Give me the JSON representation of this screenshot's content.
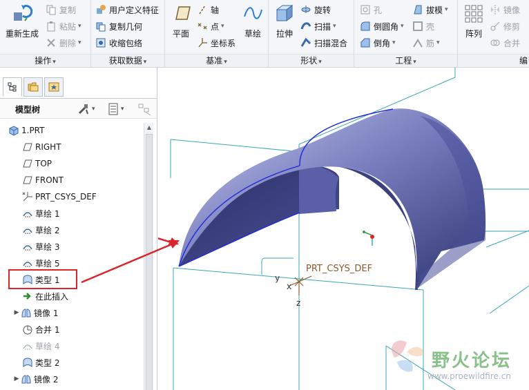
{
  "ribbon": {
    "groups": {
      "operations": "操作",
      "get_data": "获取数据",
      "datum": "基准",
      "shapes": "形状",
      "engineering": "工程",
      "editing": "编"
    },
    "regenerate": "重新生成",
    "copy": "复制",
    "paste": "粘贴",
    "delete": "删除",
    "udf": "用户定义特征",
    "copy_geometry": "复制几何",
    "shrinkwrap": "收缩包络",
    "plane": "平面",
    "axis": "轴",
    "point": "点",
    "csys": "坐标系",
    "sketch": "草绘",
    "extrude": "拉伸",
    "revolve": "旋转",
    "sweep": "扫描",
    "swept_blend": "扫描混合",
    "hole": "孔",
    "round": "倒圆角",
    "chamfer": "倒角",
    "draft": "拔模",
    "shell": "壳",
    "rib": "筋",
    "pattern": "阵列",
    "mirror": "镜像",
    "trim": "修剪",
    "merge": "合并"
  },
  "panel": {
    "tree_title": "模型树",
    "items": [
      {
        "label": "1.PRT",
        "icon": "part-icon"
      },
      {
        "label": "RIGHT",
        "icon": "datum-plane-icon"
      },
      {
        "label": "TOP",
        "icon": "datum-plane-icon"
      },
      {
        "label": "FRONT",
        "icon": "datum-plane-icon"
      },
      {
        "label": "PRT_CSYS_DEF",
        "icon": "csys-icon"
      },
      {
        "label": "草绘 1",
        "icon": "sketch-icon"
      },
      {
        "label": "草绘 2",
        "icon": "sketch-icon"
      },
      {
        "label": "草绘 3",
        "icon": "sketch-icon"
      },
      {
        "label": "草绘 5",
        "icon": "sketch-icon"
      },
      {
        "label": "类型 1",
        "icon": "boundary-blend-icon"
      },
      {
        "label": "在此插入",
        "icon": "insert-here-icon"
      },
      {
        "label": "镜像 1",
        "icon": "mirror-icon"
      },
      {
        "label": "合并 1",
        "icon": "merge-icon"
      },
      {
        "label": "草绘 4",
        "icon": "sketch-icon"
      },
      {
        "label": "类型 2",
        "icon": "boundary-blend-icon"
      },
      {
        "label": "镜像 2",
        "icon": "mirror-icon"
      }
    ]
  },
  "viewport": {
    "csys_label": "PRT_CSYS_DEF",
    "axis_x": "x",
    "axis_y": "y",
    "axis_z": "z",
    "watermark_text": "野火论坛",
    "watermark_url": "www.proewildfire.cn"
  },
  "colors": {
    "surface_light": "#a9aede",
    "surface_dark": "#262a60",
    "datum_line": "#3aa7b3",
    "edge": "#1f2bd8",
    "annotation_red": "#d9252b",
    "csys_label": "#8a5a2b"
  }
}
